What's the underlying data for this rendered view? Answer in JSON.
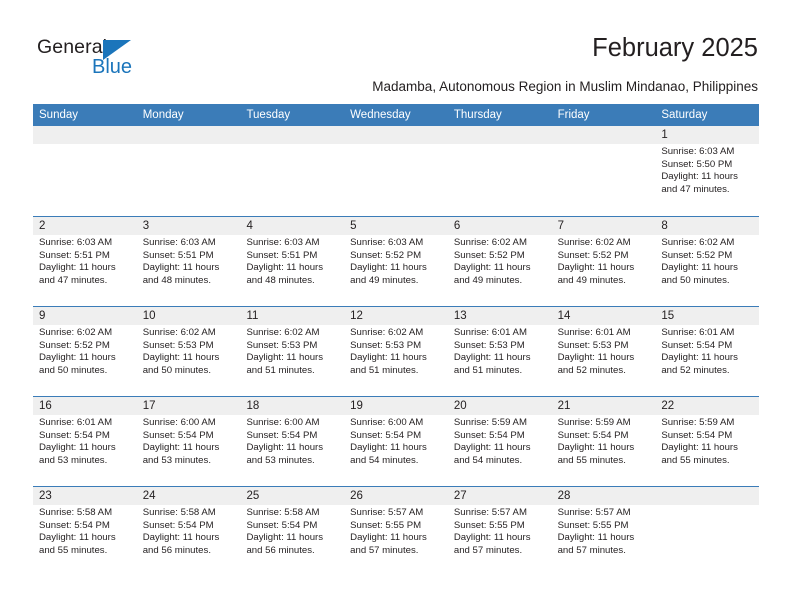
{
  "brand": {
    "name_part1": "General",
    "name_part2": "Blue",
    "accent_color": "#1b75bb"
  },
  "header": {
    "month_title": "February 2025",
    "location": "Madamba, Autonomous Region in Muslim Mindanao, Philippines"
  },
  "theme": {
    "header_blue": "#3b7cb8",
    "band_gray": "#efefef",
    "text": "#231f20"
  },
  "weekdays": [
    "Sunday",
    "Monday",
    "Tuesday",
    "Wednesday",
    "Thursday",
    "Friday",
    "Saturday"
  ],
  "weeks": [
    [
      {
        "day": "",
        "empty": true
      },
      {
        "day": "",
        "empty": true
      },
      {
        "day": "",
        "empty": true
      },
      {
        "day": "",
        "empty": true
      },
      {
        "day": "",
        "empty": true
      },
      {
        "day": "",
        "empty": true
      },
      {
        "day": "1",
        "sunrise": "Sunrise: 6:03 AM",
        "sunset": "Sunset: 5:50 PM",
        "daylight": "Daylight: 11 hours and 47 minutes."
      }
    ],
    [
      {
        "day": "2",
        "sunrise": "Sunrise: 6:03 AM",
        "sunset": "Sunset: 5:51 PM",
        "daylight": "Daylight: 11 hours and 47 minutes."
      },
      {
        "day": "3",
        "sunrise": "Sunrise: 6:03 AM",
        "sunset": "Sunset: 5:51 PM",
        "daylight": "Daylight: 11 hours and 48 minutes."
      },
      {
        "day": "4",
        "sunrise": "Sunrise: 6:03 AM",
        "sunset": "Sunset: 5:51 PM",
        "daylight": "Daylight: 11 hours and 48 minutes."
      },
      {
        "day": "5",
        "sunrise": "Sunrise: 6:03 AM",
        "sunset": "Sunset: 5:52 PM",
        "daylight": "Daylight: 11 hours and 49 minutes."
      },
      {
        "day": "6",
        "sunrise": "Sunrise: 6:02 AM",
        "sunset": "Sunset: 5:52 PM",
        "daylight": "Daylight: 11 hours and 49 minutes."
      },
      {
        "day": "7",
        "sunrise": "Sunrise: 6:02 AM",
        "sunset": "Sunset: 5:52 PM",
        "daylight": "Daylight: 11 hours and 49 minutes."
      },
      {
        "day": "8",
        "sunrise": "Sunrise: 6:02 AM",
        "sunset": "Sunset: 5:52 PM",
        "daylight": "Daylight: 11 hours and 50 minutes."
      }
    ],
    [
      {
        "day": "9",
        "sunrise": "Sunrise: 6:02 AM",
        "sunset": "Sunset: 5:52 PM",
        "daylight": "Daylight: 11 hours and 50 minutes."
      },
      {
        "day": "10",
        "sunrise": "Sunrise: 6:02 AM",
        "sunset": "Sunset: 5:53 PM",
        "daylight": "Daylight: 11 hours and 50 minutes."
      },
      {
        "day": "11",
        "sunrise": "Sunrise: 6:02 AM",
        "sunset": "Sunset: 5:53 PM",
        "daylight": "Daylight: 11 hours and 51 minutes."
      },
      {
        "day": "12",
        "sunrise": "Sunrise: 6:02 AM",
        "sunset": "Sunset: 5:53 PM",
        "daylight": "Daylight: 11 hours and 51 minutes."
      },
      {
        "day": "13",
        "sunrise": "Sunrise: 6:01 AM",
        "sunset": "Sunset: 5:53 PM",
        "daylight": "Daylight: 11 hours and 51 minutes."
      },
      {
        "day": "14",
        "sunrise": "Sunrise: 6:01 AM",
        "sunset": "Sunset: 5:53 PM",
        "daylight": "Daylight: 11 hours and 52 minutes."
      },
      {
        "day": "15",
        "sunrise": "Sunrise: 6:01 AM",
        "sunset": "Sunset: 5:54 PM",
        "daylight": "Daylight: 11 hours and 52 minutes."
      }
    ],
    [
      {
        "day": "16",
        "sunrise": "Sunrise: 6:01 AM",
        "sunset": "Sunset: 5:54 PM",
        "daylight": "Daylight: 11 hours and 53 minutes."
      },
      {
        "day": "17",
        "sunrise": "Sunrise: 6:00 AM",
        "sunset": "Sunset: 5:54 PM",
        "daylight": "Daylight: 11 hours and 53 minutes."
      },
      {
        "day": "18",
        "sunrise": "Sunrise: 6:00 AM",
        "sunset": "Sunset: 5:54 PM",
        "daylight": "Daylight: 11 hours and 53 minutes."
      },
      {
        "day": "19",
        "sunrise": "Sunrise: 6:00 AM",
        "sunset": "Sunset: 5:54 PM",
        "daylight": "Daylight: 11 hours and 54 minutes."
      },
      {
        "day": "20",
        "sunrise": "Sunrise: 5:59 AM",
        "sunset": "Sunset: 5:54 PM",
        "daylight": "Daylight: 11 hours and 54 minutes."
      },
      {
        "day": "21",
        "sunrise": "Sunrise: 5:59 AM",
        "sunset": "Sunset: 5:54 PM",
        "daylight": "Daylight: 11 hours and 55 minutes."
      },
      {
        "day": "22",
        "sunrise": "Sunrise: 5:59 AM",
        "sunset": "Sunset: 5:54 PM",
        "daylight": "Daylight: 11 hours and 55 minutes."
      }
    ],
    [
      {
        "day": "23",
        "sunrise": "Sunrise: 5:58 AM",
        "sunset": "Sunset: 5:54 PM",
        "daylight": "Daylight: 11 hours and 55 minutes."
      },
      {
        "day": "24",
        "sunrise": "Sunrise: 5:58 AM",
        "sunset": "Sunset: 5:54 PM",
        "daylight": "Daylight: 11 hours and 56 minutes."
      },
      {
        "day": "25",
        "sunrise": "Sunrise: 5:58 AM",
        "sunset": "Sunset: 5:54 PM",
        "daylight": "Daylight: 11 hours and 56 minutes."
      },
      {
        "day": "26",
        "sunrise": "Sunrise: 5:57 AM",
        "sunset": "Sunset: 5:55 PM",
        "daylight": "Daylight: 11 hours and 57 minutes."
      },
      {
        "day": "27",
        "sunrise": "Sunrise: 5:57 AM",
        "sunset": "Sunset: 5:55 PM",
        "daylight": "Daylight: 11 hours and 57 minutes."
      },
      {
        "day": "28",
        "sunrise": "Sunrise: 5:57 AM",
        "sunset": "Sunset: 5:55 PM",
        "daylight": "Daylight: 11 hours and 57 minutes."
      },
      {
        "day": "",
        "empty": true
      }
    ]
  ]
}
